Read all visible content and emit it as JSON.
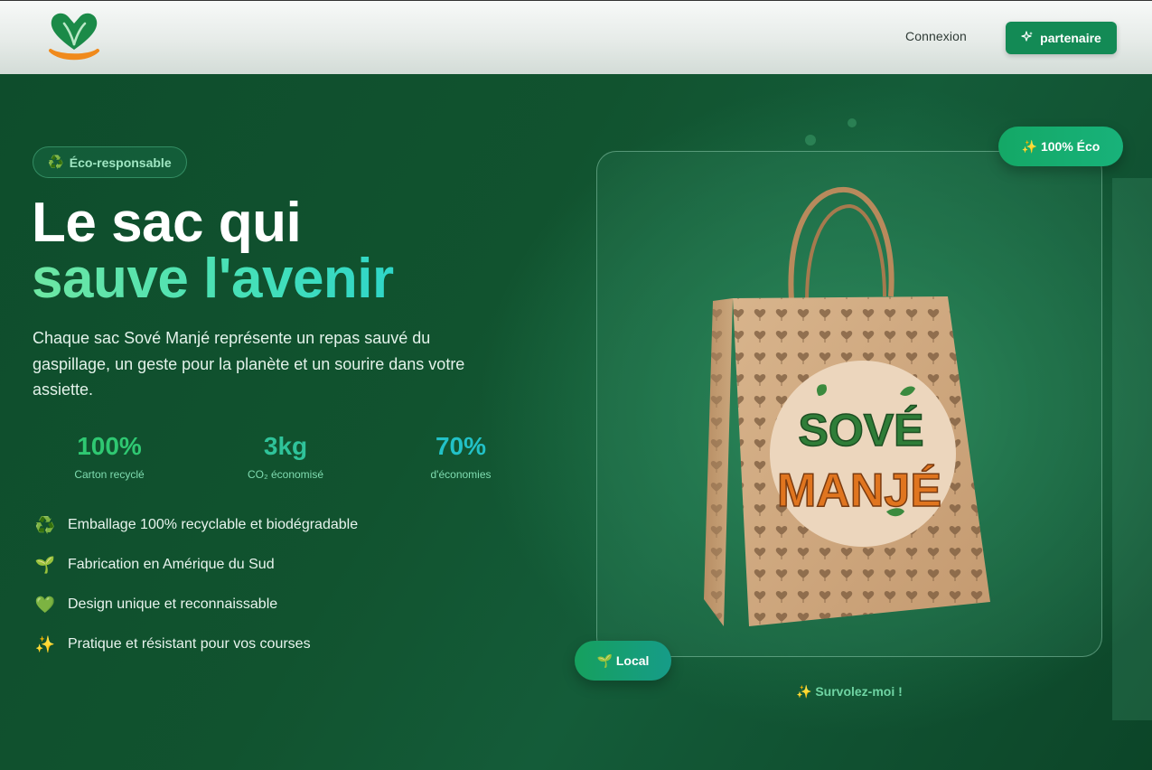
{
  "header": {
    "logo_icon": "heart-leaf-smile-logo",
    "login_label": "Connexion",
    "partner_icon": "sparkles-icon",
    "partner_label": "partenaire"
  },
  "hero": {
    "badge": {
      "icon": "recycle-icon",
      "label": "Éco-responsable"
    },
    "title_line1": "Le sac qui",
    "title_line2": "sauve l'avenir",
    "description": "Chaque sac Sové Manjé représente un repas sauvé du gaspillage, un geste pour la planète et un sourire dans votre assiette.",
    "stats": [
      {
        "value": "100%",
        "label": "Carton recyclé",
        "color": "#2fc872"
      },
      {
        "value": "3kg",
        "label": "CO₂ économisé",
        "color": "#2fc39a"
      },
      {
        "value": "70%",
        "label": "d'économies",
        "color": "#22c1c7"
      }
    ],
    "features": [
      {
        "icon": "recycle-icon",
        "label": "Emballage 100% recyclable et biodégradable"
      },
      {
        "icon": "seedling-icon",
        "label": "Fabrication en Amérique du Sud"
      },
      {
        "icon": "green-heart-icon",
        "label": "Design unique et reconnaissable"
      },
      {
        "icon": "sparkles-icon",
        "label": "Pratique et résistant pour vos courses"
      }
    ]
  },
  "product": {
    "brand_line1": "SOVÉ",
    "brand_line2": "MANJÉ",
    "badge_eco": "✨ 100% Éco",
    "badge_local": "🌱 Local",
    "hover_hint": "✨ Survolez-moi !"
  },
  "colors": {
    "accent": "#138a55",
    "hero_bg": "#0e4d2c",
    "kraft": "#c9a27a"
  }
}
